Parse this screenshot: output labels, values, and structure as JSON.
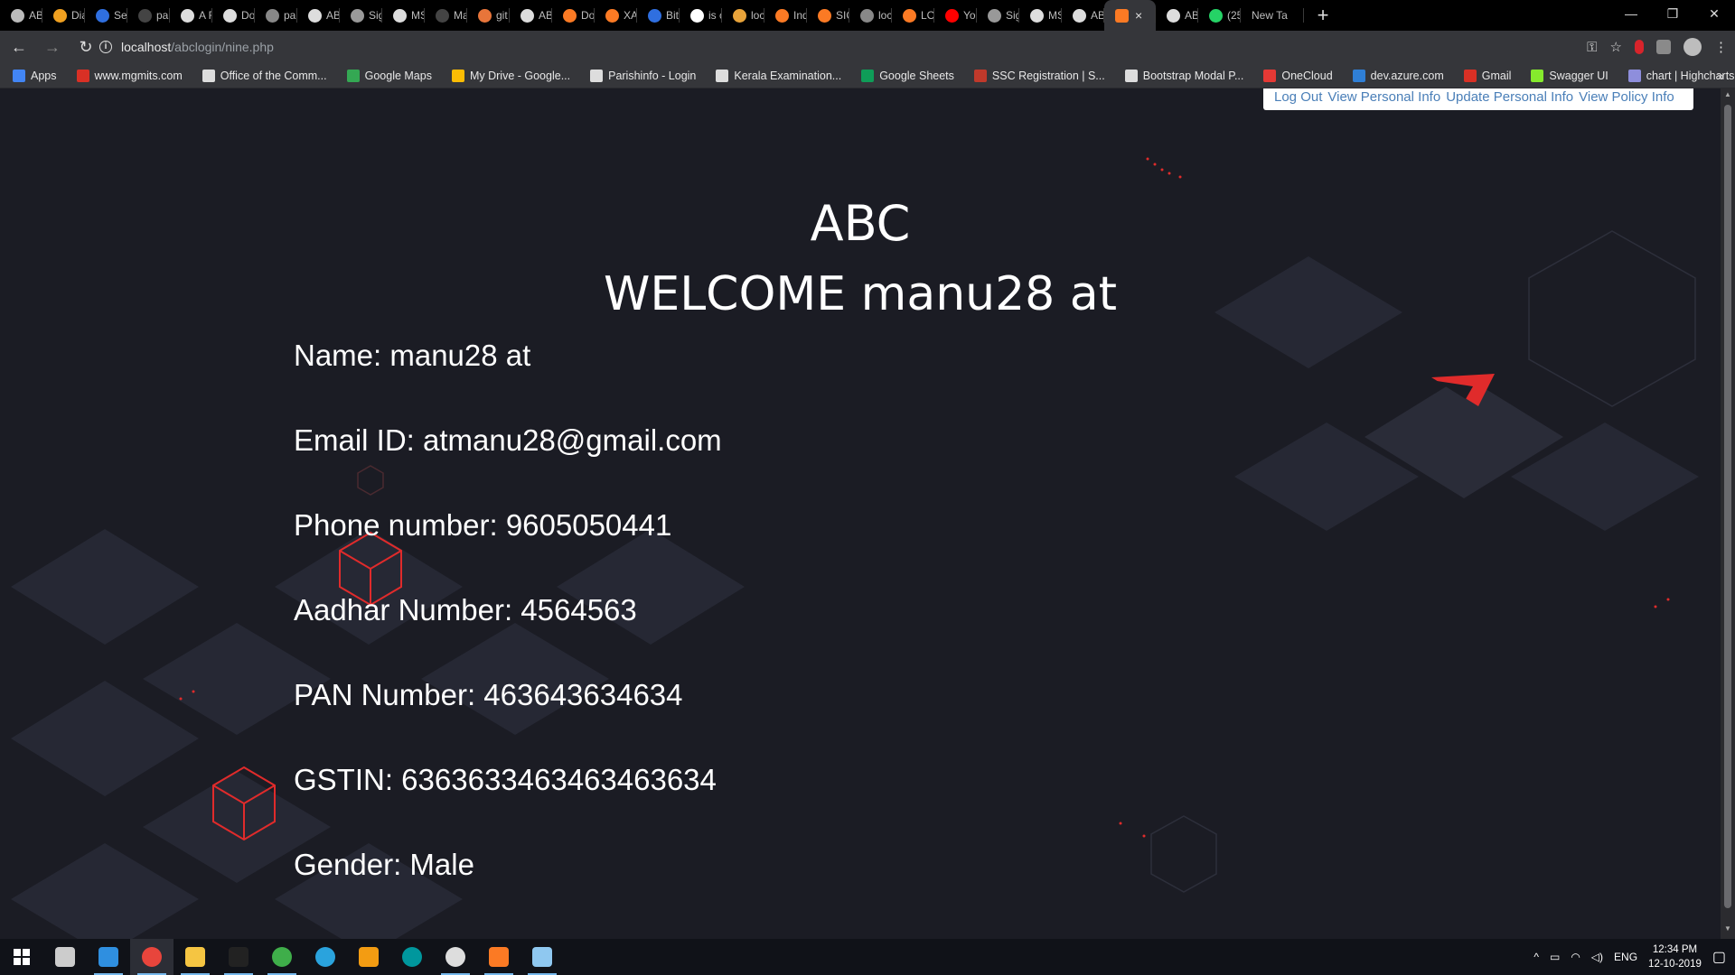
{
  "browser": {
    "tabs": [
      {
        "label": "AB",
        "color": "#bbbbbb"
      },
      {
        "label": "Dia",
        "color": "#f0a020"
      },
      {
        "label": "Ser",
        "color": "#2f6fe0"
      },
      {
        "label": "par",
        "color": "#444444"
      },
      {
        "label": "A F",
        "color": "#dddddd"
      },
      {
        "label": "Do",
        "color": "#dddddd"
      },
      {
        "label": "par",
        "color": "#888888"
      },
      {
        "label": "AB",
        "color": "#dddddd"
      },
      {
        "label": "Sig",
        "color": "#999999"
      },
      {
        "label": "MS",
        "color": "#dddddd"
      },
      {
        "label": "Ma",
        "color": "#444444"
      },
      {
        "label": "git",
        "color": "#e8753a"
      },
      {
        "label": "AB",
        "color": "#dddddd"
      },
      {
        "label": "Do",
        "color": "#fb7a24"
      },
      {
        "label": "XA",
        "color": "#fb7a24"
      },
      {
        "label": "Bit",
        "color": "#2f6fe0"
      },
      {
        "label": "is c",
        "color": "#ffffff"
      },
      {
        "label": "loc",
        "color": "#e8a33a"
      },
      {
        "label": "Ind",
        "color": "#fb7a24"
      },
      {
        "label": "SIC",
        "color": "#fb7a24"
      },
      {
        "label": "loc",
        "color": "#888888"
      },
      {
        "label": "LO",
        "color": "#fb7a24"
      },
      {
        "label": "You",
        "color": "#ff0000"
      },
      {
        "label": "Sig",
        "color": "#999999"
      },
      {
        "label": "MS",
        "color": "#dddddd"
      },
      {
        "label": "AB",
        "color": "#dddddd"
      }
    ],
    "active_tab": {
      "color": "#fb7a24",
      "close": "×"
    },
    "tabs_after": [
      {
        "label": "AB",
        "color": "#dddddd"
      },
      {
        "label": "(25",
        "color": "#25d366"
      }
    ],
    "new_tab_label": "New Ta",
    "add_tab": "+",
    "window_controls": {
      "minimize": "—",
      "restore": "❐",
      "close": "✕"
    },
    "nav": {
      "back": "←",
      "forward": "→",
      "reload": "↻"
    },
    "url": {
      "host": "localhost",
      "path": "/abclogin/nine.php",
      "info": "i"
    },
    "toolbar_icons": {
      "key": "⚿",
      "star": "☆",
      "menu": "⋮"
    },
    "bookmarks": [
      {
        "label": "Apps",
        "color": "#4285f4"
      },
      {
        "label": "www.mgmits.com",
        "color": "#d93025"
      },
      {
        "label": "Office of the Comm...",
        "color": "#dddddd"
      },
      {
        "label": "Google Maps",
        "color": "#34a853"
      },
      {
        "label": "My Drive - Google...",
        "color": "#fbbc04"
      },
      {
        "label": "Parishinfo - Login",
        "color": "#dddddd"
      },
      {
        "label": "Kerala Examination...",
        "color": "#dddddd"
      },
      {
        "label": "Google Sheets",
        "color": "#0f9d58"
      },
      {
        "label": "SSC Registration | S...",
        "color": "#c0392b"
      },
      {
        "label": "Bootstrap Modal P...",
        "color": "#dddddd"
      },
      {
        "label": "OneCloud",
        "color": "#e53935"
      },
      {
        "label": "dev.azure.com",
        "color": "#2f7fd6"
      },
      {
        "label": "Gmail",
        "color": "#d93025"
      },
      {
        "label": "Swagger UI",
        "color": "#85ea2d"
      },
      {
        "label": "chart | Highcharts A...",
        "color": "#8e8edc"
      }
    ],
    "bookmarks_more": "»"
  },
  "page": {
    "nav_links": [
      "Log Out",
      "View Personal Info",
      "Update Personal Info",
      "View Policy Info"
    ],
    "brand": "ABC",
    "welcome": "WELCOME manu28 at",
    "fields": [
      "Name: manu28 at",
      "Email ID: atmanu28@gmail.com",
      "Phone number: 9605050441",
      "Aadhar Number: 4564563",
      "PAN Number: 463643634634",
      "GSTIN: 6363633463463463634",
      "Gender: Male"
    ],
    "accent_color": "#e02b2b"
  },
  "taskbar": {
    "apps": [
      {
        "name": "task-view",
        "color": "#cccccc"
      },
      {
        "name": "vscode",
        "color": "#2f8fe0"
      },
      {
        "name": "chrome",
        "color": "#e8453c"
      },
      {
        "name": "file-explorer",
        "color": "#f5c542"
      },
      {
        "name": "terminal",
        "color": "#222222"
      },
      {
        "name": "edge",
        "color": "#3fae4a"
      },
      {
        "name": "telegram",
        "color": "#2aa3dd"
      },
      {
        "name": "sublime",
        "color": "#f39c12"
      },
      {
        "name": "arduino",
        "color": "#00979d"
      },
      {
        "name": "eclipse",
        "color": "#dddddd"
      },
      {
        "name": "xampp",
        "color": "#fb7a24"
      },
      {
        "name": "notepad",
        "color": "#8fc8f0"
      }
    ],
    "language": "ENG",
    "time": "12:34 PM",
    "date": "12-10-2019",
    "tray_icons": "^"
  }
}
